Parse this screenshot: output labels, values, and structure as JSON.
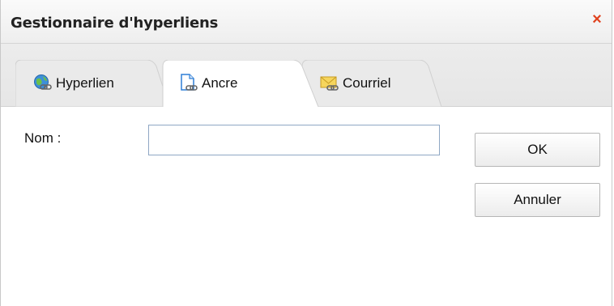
{
  "dialog": {
    "title": "Gestionnaire d'hyperliens",
    "close_symbol": "×",
    "close_icon": "close-icon"
  },
  "tabs": [
    {
      "label": "Hyperlien",
      "icon": "globe-link-icon",
      "selected": false
    },
    {
      "label": "Ancre",
      "icon": "document-link-icon",
      "selected": true
    },
    {
      "label": "Courriel",
      "icon": "envelope-link-icon",
      "selected": false
    }
  ],
  "form": {
    "name_label": "Nom :",
    "name_value": "",
    "name_placeholder": ""
  },
  "buttons": {
    "ok_label": "OK",
    "cancel_label": "Annuler"
  },
  "colors": {
    "close": "#e0421e",
    "input_border": "#8fa7c4",
    "link_blue": "#2f7fd6"
  }
}
